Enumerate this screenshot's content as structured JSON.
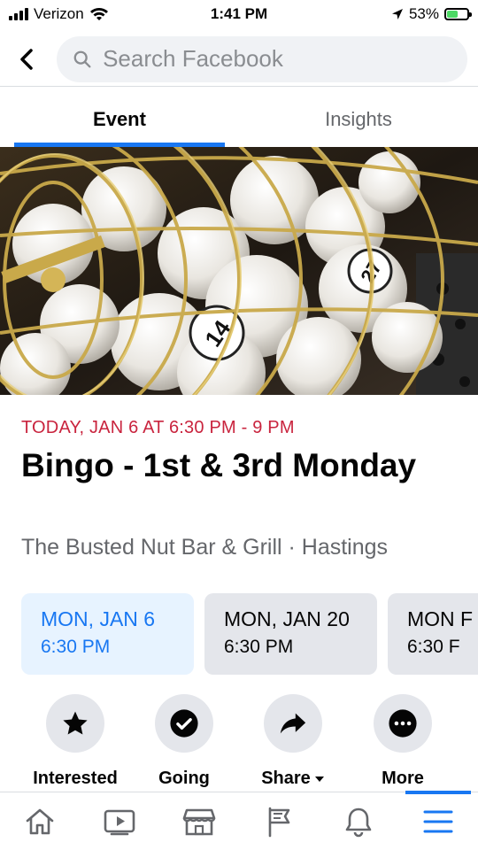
{
  "status_bar": {
    "carrier": "Verizon",
    "time": "1:41 PM",
    "battery_percent": "53%",
    "battery_fill": 0.53
  },
  "header": {
    "search_placeholder": "Search Facebook"
  },
  "tabs": [
    {
      "label": "Event",
      "active": true
    },
    {
      "label": "Insights",
      "active": false
    }
  ],
  "cover": {
    "ball_numbers": [
      "27",
      "14"
    ]
  },
  "event": {
    "datetime": "TODAY, JAN 6 AT 6:30 PM - 9 PM",
    "title": "Bingo - 1st & 3rd Monday",
    "venue": "The Busted Nut Bar & Grill · Hastings"
  },
  "dates": [
    {
      "date": "MON, JAN 6",
      "time": "6:30 PM",
      "selected": true
    },
    {
      "date": "MON, JAN 20",
      "time": "6:30 PM",
      "selected": false
    },
    {
      "date": "MON F",
      "time": "6:30 F",
      "selected": false
    }
  ],
  "actions": [
    {
      "label": "Interested",
      "icon": "star-icon"
    },
    {
      "label": "Going",
      "icon": "check-circle-icon"
    },
    {
      "label": "Share",
      "icon": "share-arrow-icon"
    },
    {
      "label": "More",
      "icon": "more-dots-icon"
    }
  ],
  "bottom_nav": [
    {
      "icon": "home-icon"
    },
    {
      "icon": "watch-video-icon"
    },
    {
      "icon": "marketplace-icon"
    },
    {
      "icon": "pages-flag-icon"
    },
    {
      "icon": "notifications-bell-icon"
    },
    {
      "icon": "menu-icon",
      "active": true
    }
  ],
  "colors": {
    "accent": "#1877f2",
    "date_red": "#c9243e",
    "secondary_text": "#65676b",
    "button_bg": "#e4e6eb",
    "selected_bg": "#e7f3ff"
  }
}
